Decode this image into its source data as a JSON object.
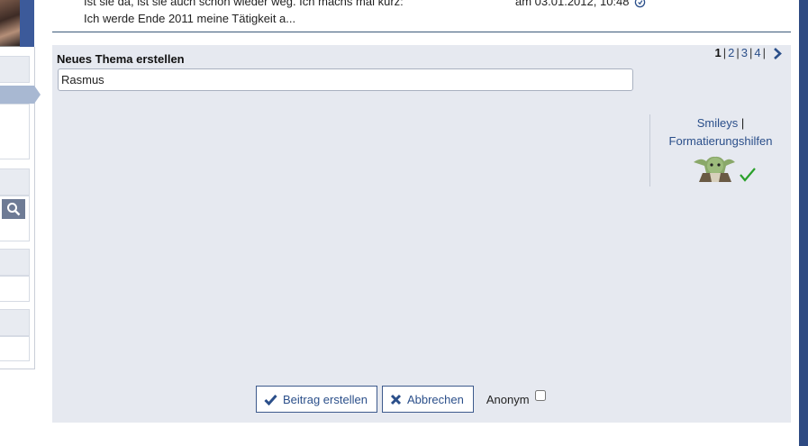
{
  "top_post": {
    "line1": "Ist sie da, ist sie auch schon wieder weg. Ich machs mal kurz:",
    "line2": "Ich werde Ende 2011 meine Tätigkeit a...",
    "date": "am 03.01.2012, 10:48"
  },
  "form": {
    "title": "Neues Thema erstellen",
    "subject_value": "Rasmus"
  },
  "pager": {
    "current": "1",
    "pages": [
      "2",
      "3",
      "4"
    ]
  },
  "sidebar_tools": {
    "smileys_label": "Smileys",
    "formatting_label": "Formatierungshilfen"
  },
  "actions": {
    "submit_label": "Beitrag erstellen",
    "cancel_label": "Abbrechen",
    "anonymous_label": "Anonym"
  },
  "colors": {
    "panel_bg": "#e6e9f0",
    "link": "#2b4f8a",
    "accent_bar": "#2e4a82",
    "check_green": "#2aa02a"
  },
  "icons": [
    "search-icon",
    "chevron-right-icon",
    "checkmark-icon",
    "x-icon",
    "yoda-smiley-icon",
    "info-icon"
  ]
}
